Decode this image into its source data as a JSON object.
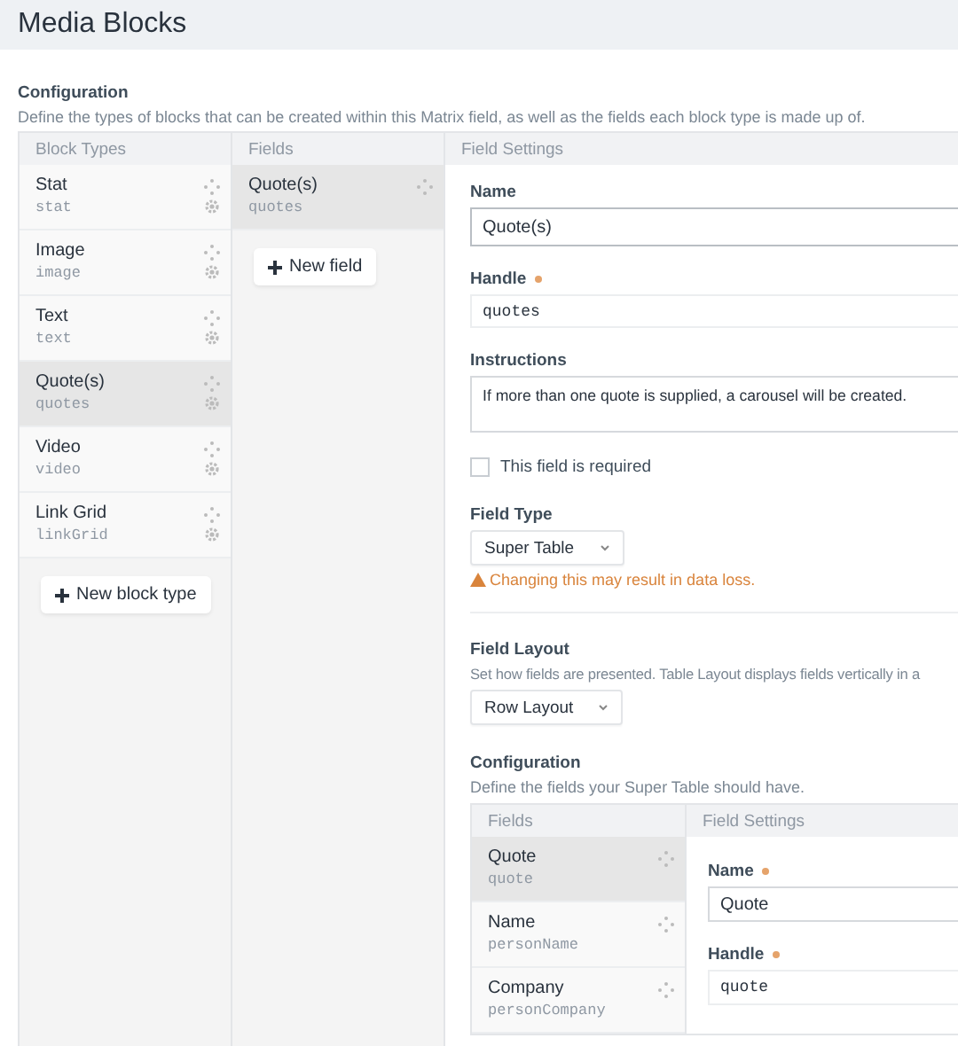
{
  "page": {
    "title": "Media Blocks"
  },
  "configuration": {
    "heading": "Configuration",
    "description": "Define the types of blocks that can be created within this Matrix field, as well as the fields each block type is made up of.",
    "columns": [
      "Block Types",
      "Fields",
      "Field Settings"
    ],
    "block_types": [
      {
        "name": "Stat",
        "handle": "stat",
        "selected": false
      },
      {
        "name": "Image",
        "handle": "image",
        "selected": false
      },
      {
        "name": "Text",
        "handle": "text",
        "selected": false
      },
      {
        "name": "Quote(s)",
        "handle": "quotes",
        "selected": true
      },
      {
        "name": "Video",
        "handle": "video",
        "selected": false
      },
      {
        "name": "Link Grid",
        "handle": "linkGrid",
        "selected": false
      }
    ],
    "new_block_type_button": "New block type",
    "fields": [
      {
        "name": "Quote(s)",
        "handle": "quotes",
        "selected": true
      }
    ],
    "new_field_button": "New field",
    "settings": {
      "name": {
        "label": "Name",
        "value": "Quote(s)"
      },
      "handle": {
        "label": "Handle",
        "value": "quotes",
        "required": true
      },
      "instructions": {
        "label": "Instructions",
        "value": "If more than one quote is supplied, a carousel will be created."
      },
      "required_checkbox": {
        "label": "This field is required",
        "checked": false
      },
      "field_type": {
        "label": "Field Type",
        "value": "Super Table",
        "warning": "Changing this may result in data loss."
      },
      "field_layout": {
        "label": "Field Layout",
        "description": "Set how fields are presented. Table Layout displays fields vertically in a",
        "value": "Row Layout"
      },
      "sub_configuration": {
        "heading": "Configuration",
        "description": "Define the fields your Super Table should have.",
        "columns": [
          "Fields",
          "Field Settings"
        ],
        "fields": [
          {
            "name": "Quote",
            "handle": "quote",
            "selected": true
          },
          {
            "name": "Name",
            "handle": "personName",
            "selected": false
          },
          {
            "name": "Company",
            "handle": "personCompany",
            "selected": false
          }
        ],
        "name": {
          "label": "Name",
          "value": "Quote",
          "required": true
        },
        "handle": {
          "label": "Handle",
          "value": "quote",
          "required": true
        }
      }
    }
  }
}
